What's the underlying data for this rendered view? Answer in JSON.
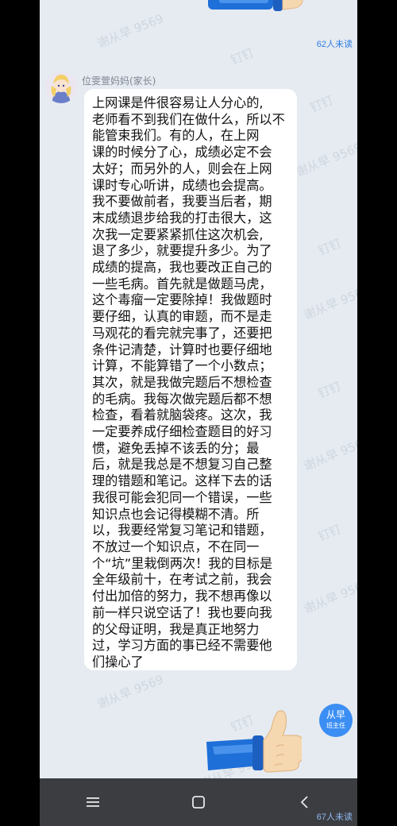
{
  "chat": {
    "top_unread": "62人未读",
    "sender_name": "位雯萱妈妈(家长)",
    "message_lines": [
      "上网课是件很容易让人分心的,",
      "老师看不到我们在做什么，所以不",
      "能管束我们。有的人，在上网",
      "课的时候分了心，成绩必定不会",
      "太好；而另外的人，则会在上网",
      "课时专心听讲，成绩也会提高。",
      "我不要做前者，我要当后者，期",
      "末成绩退步给我的打击很大，这",
      "次我一定要紧紧抓住这次机会,",
      "退了多少，就要提升多少。为了",
      "成绩的提高，我也要改正自己的",
      "一些毛病。首先就是做题马虎，",
      "这个毒瘤一定要除掉！我做题时",
      "要仔细，认真的审题，而不是走",
      "马观花的看完就完事了，还要把",
      "条件记清楚，计算时也要仔细地",
      "计算，不能算错了一个小数点；",
      "其次，就是我做完题后不想检查",
      "的毛病。我每次做完题后都不想",
      "检查，看着就脑袋疼。这次，我",
      "一定要养成仔细检查题目的好习",
      "惯，避免丢掉不该丢的分；最",
      "后，就是我总是不想复习自己整",
      "理的错题和笔记。这样下去的话",
      "我很可能会犯同一个错误，一些",
      "知识点也会记得模糊不清。所",
      "以，我要经常复习笔记和错题，",
      "不放过一个知识点，不在同一",
      "个“坑”里栽倒两次！我的目标是",
      "全年级前十，在考试之前，我会",
      "付出加倍的努力，我不想再像以",
      "前一样只说空话了！我也要向我",
      "的父母证明，我是真正地努力",
      "过，学习方面的事已经不需要他",
      "们操心了"
    ],
    "teacher_avatar_name": "从早",
    "teacher_avatar_role": "班主任",
    "bottom_unread": "67人未读",
    "watermark_text": "谢从早 9569",
    "watermark_short": "钉钉"
  },
  "nav": {
    "menu_icon": "menu-icon",
    "home_icon": "home-square-icon",
    "back_icon": "back-chevron-icon"
  },
  "colors": {
    "chat_bg": "#e6ebf1",
    "bubble_bg": "#ffffff",
    "accent": "#2f7de1",
    "avatar_blue": "#3b8ef3",
    "navbar": "#3c3d41"
  }
}
